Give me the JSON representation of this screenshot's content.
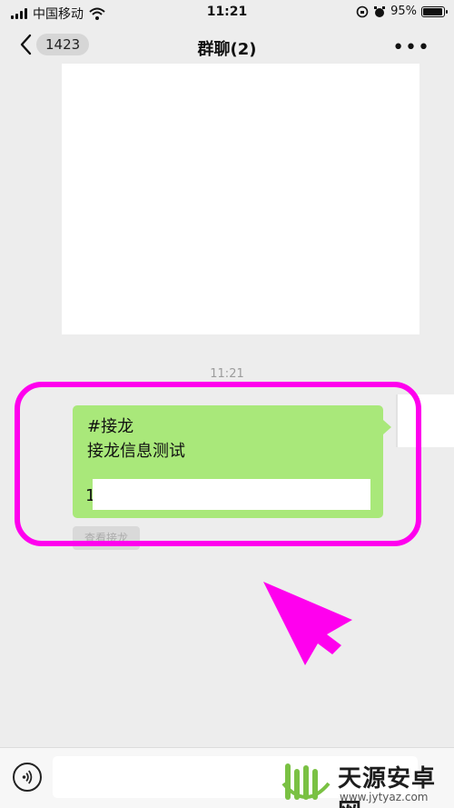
{
  "status_bar": {
    "carrier": "中国移动",
    "time": "11:21",
    "battery": "95%",
    "battery_level": 0.95
  },
  "nav": {
    "back_badge": "1423",
    "title": "群聊(2)",
    "more_label": "•••"
  },
  "chat": {
    "timestamp": "11:21",
    "message": {
      "line1": "#接龙",
      "line2": "接龙信息测试",
      "item_prefix": "1"
    },
    "view_button": "查看接龙"
  },
  "watermark": {
    "name": "天源安卓网",
    "url": "www.jytyaz.com"
  },
  "colors": {
    "bubble": "#a9e87a",
    "highlight": "#ff00ee",
    "background": "#ededed"
  },
  "icons": [
    "wifi-icon",
    "signal-icon",
    "lock-rotation-icon",
    "alarm-icon",
    "battery-icon",
    "back-chevron-icon",
    "more-icon",
    "voice-icon",
    "android-logo-icon"
  ]
}
